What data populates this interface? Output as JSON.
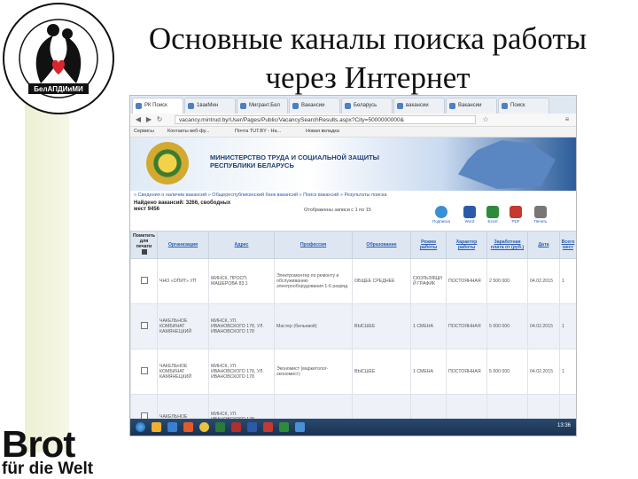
{
  "slide": {
    "title_line1": "Основные каналы поиска работы",
    "title_line2": "через Интернет"
  },
  "logo_top": {
    "ring_text": "ОО «Белорусская ассоциация помощи детям-инвалидам и молодым инвалидам»",
    "label": "БелАПДИиМИ"
  },
  "logo_bottom": {
    "line1": "Brot",
    "line2": "für die Welt"
  },
  "browser": {
    "tabs": [
      {
        "label": "РК Поиск"
      },
      {
        "label": "1вакМин"
      },
      {
        "label": "Мигрант.Бел"
      },
      {
        "label": "Вакансии"
      },
      {
        "label": "Беларусь"
      },
      {
        "label": "вакансии"
      },
      {
        "label": "Вакансии"
      },
      {
        "label": "Поиск"
      }
    ],
    "url": "vacancy.mintrud.by/User/Pages/Public/VacancySearchResults.aspx?City=5000000000&",
    "bookmarks": [
      "Сервисы",
      "Контакты веб-фу...",
      "Почта TUT.BY - На...",
      "Новая вкладка"
    ],
    "colors": {
      "tabbar": "#dfe7f1",
      "banner_blue": "#2d5d9a",
      "link": "#2a5db0",
      "header_bg": "#dde6f1"
    }
  },
  "site": {
    "ministry_line1": "МИНИСТЕРСТВО ТРУДА И СОЦИАЛЬНОЙ ЗАЩИТЫ",
    "ministry_line2": "РЕСПУБЛИКИ БЕЛАРУСЬ",
    "breadcrumb": "» Сведения о наличии вакансий » Общереспубликанский банк вакансий » Поиск вакансий » Результаты поиска",
    "found": "Найдено вакансий: 3266, свободных мест 9456",
    "shown": "Отображены записи с 1 по 15",
    "export": [
      {
        "label": "Подписка",
        "icon": "subscribe-icon",
        "color": "#3a8fd6"
      },
      {
        "label": "Word",
        "icon": "word-icon",
        "color": "#2b5ba8"
      },
      {
        "label": "Excel",
        "icon": "excel-icon",
        "color": "#2e8b3d"
      },
      {
        "label": "PDF",
        "icon": "pdf-icon",
        "color": "#c43a2f"
      },
      {
        "label": "Печать",
        "icon": "print-icon",
        "color": "#777777"
      }
    ],
    "columns": [
      "Пометить для печати",
      "Организация",
      "Адрес",
      "Профессия",
      "Образование",
      "Режим работы",
      "Характер работы",
      "Заработная плата от (руб.)",
      "Дата",
      "Всего мест"
    ],
    "rows": [
      [
        "ЧНО «ОПИТ» УП",
        "МИНСК, ПРОСП. МАШЕРОВА 83,1",
        "Электромонтер по ремонту и обслуживанию электрооборудования 1-6 разряд",
        "ОБЩЕЕ СРЕДНЕЕ",
        "СКОЛЬЗЯЩИЙ ГРАФИК",
        "ПОСТОЯННАЯ",
        "2 500 000",
        "04.02.2015",
        "1"
      ],
      [
        "ЧАКЕЛЬНОЕ КОМБИНАТ КАМЯНЕЦКИЙ",
        "МИНСК, УЛ. ИВАНОВСКОГО 178, УЛ. ИВАНОВСКОГО 178",
        "Мастер (бельевой)",
        "ВЫСШЕЕ",
        "1 СМЕНА",
        "ПОСТОЯННАЯ",
        "5 000 000",
        "04.02.2015",
        "1"
      ],
      [
        "ЧАКЕЛЬНОЕ КОМБИНАТ КАМЯНЕЦКИЙ",
        "МИНСК, УЛ. ИВАНОВСКОГО 178, УЛ. ИВАНОВСКОГО 178",
        "Экономист (маркетолог-экономист)",
        "ВЫСШЕЕ",
        "1 СМЕНА",
        "ПОСТОЯННАЯ",
        "5 000 000",
        "04.02.2015",
        "1"
      ],
      [
        "ЧАКЕЛЬНОЕ",
        "МИНСК, УЛ. ИВАНОВСКОГО 178",
        "",
        "",
        "",
        "",
        "",
        "",
        ""
      ]
    ]
  },
  "taskbar": {
    "clock": "13:36"
  }
}
